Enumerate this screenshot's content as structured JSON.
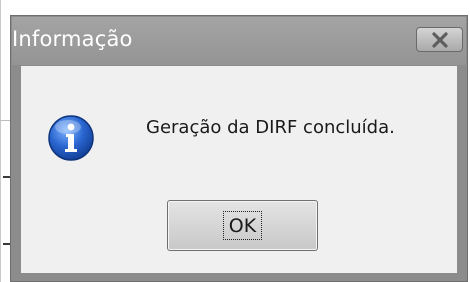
{
  "dialog": {
    "title": "Informação",
    "message": "Geração da DIRF concluída.",
    "ok_label": "OK",
    "close_icon": "close-x-icon",
    "status_icon": "info-icon"
  },
  "colors": {
    "titlebar": "#9a9a9a",
    "title_text": "#ffffff",
    "client_bg": "#f0f0f0",
    "info_icon_blue": "#1f5bc4"
  }
}
